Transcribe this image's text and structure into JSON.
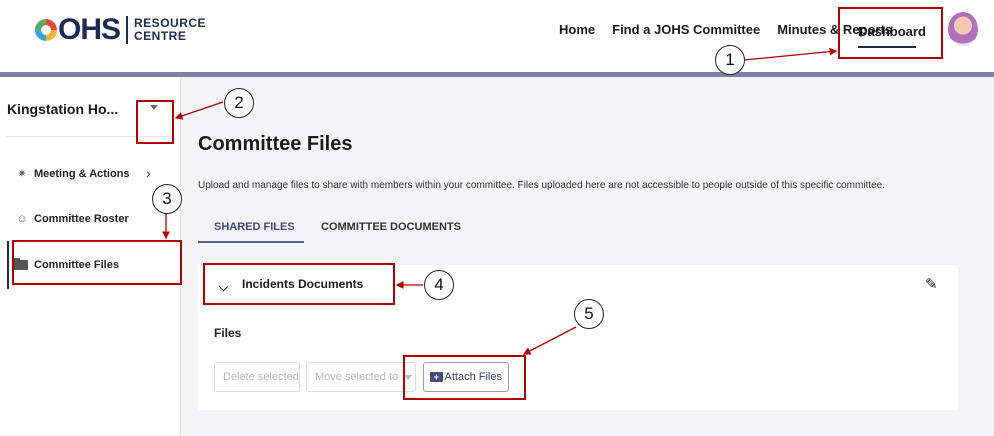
{
  "header": {
    "logo_mark": "OHS",
    "logo_text_line1": "RESOURCE",
    "logo_text_line2": "CENTRE",
    "nav": [
      {
        "label": "Home"
      },
      {
        "label": "Find a JOHS Committee"
      },
      {
        "label": "Minutes & Reports"
      },
      {
        "label": "Dashboard",
        "active": true
      }
    ]
  },
  "sidebar": {
    "workspace": "Kingstation Ho...",
    "items": [
      {
        "label": "Meeting & Actions",
        "icon": "meeting-icon"
      },
      {
        "label": "Committee Roster",
        "icon": "people-icon"
      },
      {
        "label": "Committee Files",
        "icon": "folder-icon",
        "active": true
      }
    ]
  },
  "main": {
    "title": "Committee Files",
    "description": "Upload and manage files to share with members within your committee. Files uploaded here are not accessible to people outside of this specific committee.",
    "tabs": [
      {
        "label": "SHARED FILES",
        "active": true
      },
      {
        "label": "COMMITTEE DOCUMENTS"
      }
    ],
    "accordion": {
      "title": "Incidents Documents",
      "files_label": "Files",
      "buttons": {
        "delete": "Delete selected",
        "move": "Move selected to",
        "attach": "Attach Files"
      }
    }
  },
  "annotations": {
    "labels": [
      "1",
      "2",
      "3",
      "4",
      "5"
    ],
    "color": "#b00000"
  },
  "colors": {
    "brand_navy": "#1d2a52",
    "accent_bar": "#7f7fa6",
    "tab_active": "#44447a"
  }
}
